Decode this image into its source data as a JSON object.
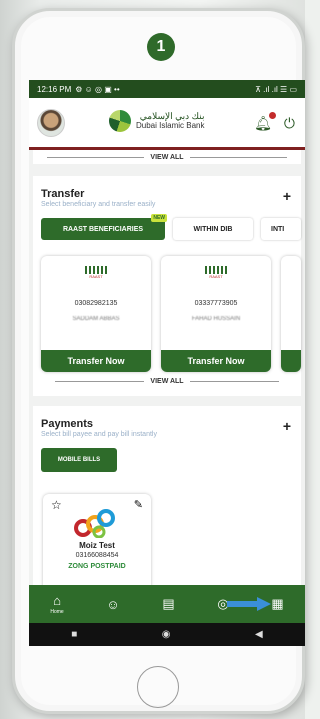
{
  "step_number": "1",
  "status_bar": {
    "time": "12:16 PM",
    "left_icons": "⚙ ☺ ◎ ▣ ••",
    "right_icons": "⊼ .ıl .ıl ☰ ▭"
  },
  "header": {
    "bank_name_ar": "بنك دبي الإسلامي",
    "bank_name_en": "Dubai Islamic Bank"
  },
  "view_all_label": "VIEW ALL",
  "transfer": {
    "title": "Transfer",
    "subtitle": "Select beneficiary and transfer easily",
    "tabs": [
      {
        "label": "RAAST BENEFICIARIES",
        "badge": "NEW"
      },
      {
        "label": "WITHIN DIB"
      },
      {
        "label": "INTI"
      }
    ],
    "cards": [
      {
        "logo_text": "RAAST",
        "account": "03082982135",
        "name": "SADDAM ABBAS",
        "button": "Transfer Now"
      },
      {
        "logo_text": "RAAST",
        "account": "03337773905",
        "name": "FAHAD HUSSAIN",
        "button": "Transfer Now"
      }
    ]
  },
  "payments": {
    "title": "Payments",
    "subtitle": "Select bill payee and pay bill instantly",
    "mobile_bills_label": "MOBILE BILLS",
    "card": {
      "name": "Moiz Test",
      "number": "03166088454",
      "type": "ZONG POSTPAID"
    }
  },
  "bottom_nav": {
    "home_label": "Home"
  },
  "colors": {
    "primary_green": "#2e6b2a",
    "status_bar": "#234d1e",
    "accent_blue_arrow": "#3a8fd8"
  }
}
